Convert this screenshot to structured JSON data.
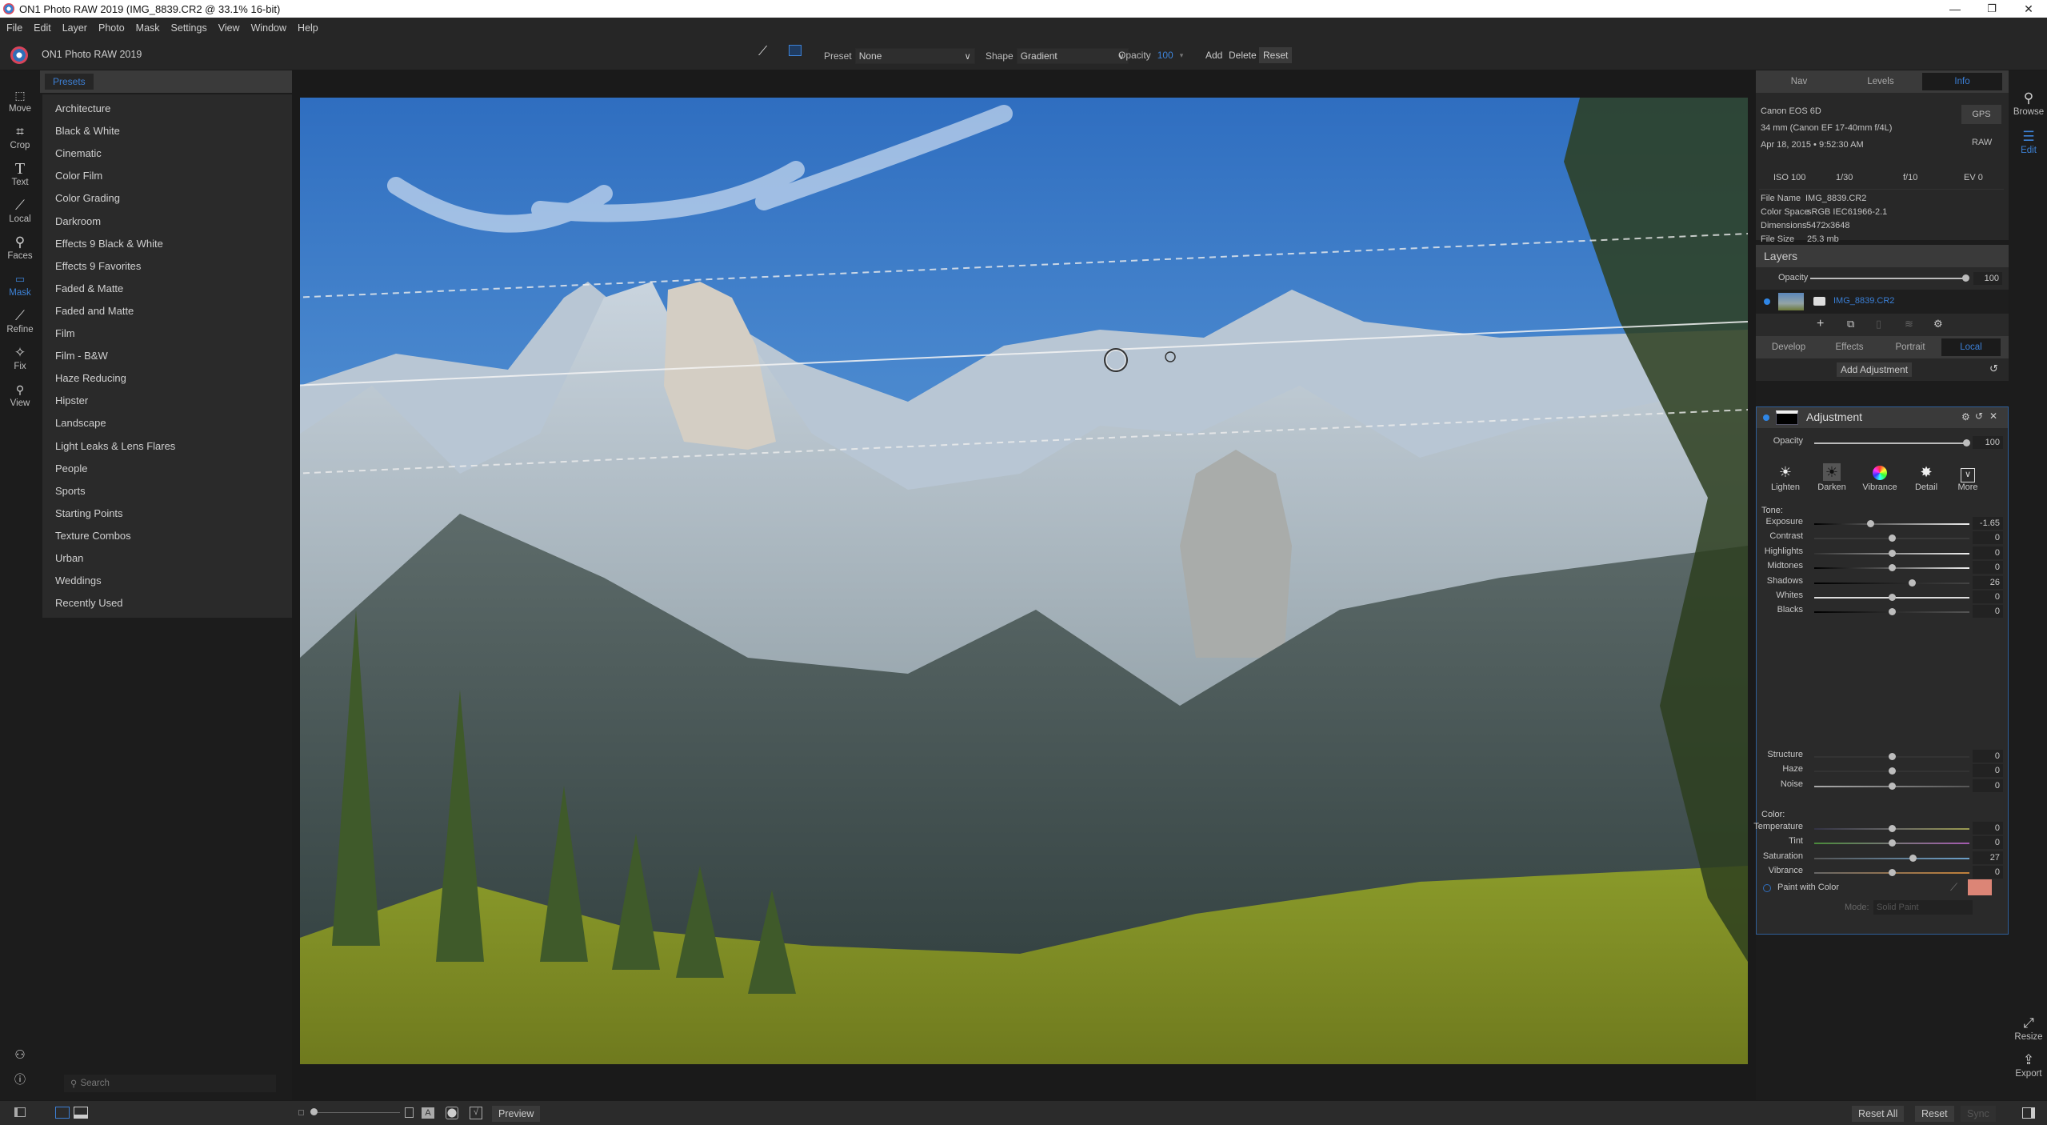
{
  "window": {
    "title": "ON1 Photo RAW 2019 (IMG_8839.CR2 @ 33.1% 16-bit)",
    "controls": {
      "minimize": "—",
      "maximize": "❐",
      "close": "✕"
    }
  },
  "menu": [
    "File",
    "Edit",
    "Layer",
    "Photo",
    "Mask",
    "Settings",
    "View",
    "Window",
    "Help"
  ],
  "app": {
    "name": "ON1 Photo RAW 2019"
  },
  "toolbar": {
    "preset_label": "Preset",
    "preset_value": "None",
    "shape_label": "Shape",
    "shape_value": "Gradient",
    "opacity_label": "Opacity",
    "opacity_value": "100",
    "add_label": "Add",
    "delete_label": "Delete",
    "reset_label": "Reset",
    "accent_color": "#3d82d6"
  },
  "tools": [
    {
      "label": "Move",
      "icon": "move-icon"
    },
    {
      "label": "Crop",
      "icon": "crop-icon"
    },
    {
      "label": "Text",
      "icon": "text-icon"
    },
    {
      "label": "Local",
      "icon": "local-brush-icon"
    },
    {
      "label": "Faces",
      "icon": "faces-icon"
    },
    {
      "label": "Mask",
      "icon": "mask-icon",
      "active": true
    },
    {
      "label": "Refine",
      "icon": "refine-icon"
    },
    {
      "label": "Fix",
      "icon": "fix-icon"
    },
    {
      "label": "View",
      "icon": "zoom-icon"
    }
  ],
  "presets": {
    "tab_label": "Presets",
    "items": [
      "Architecture",
      "Black & White",
      "Cinematic",
      "Color Film",
      "Color Grading",
      "Darkroom",
      "Effects 9 Black & White",
      "Effects 9 Favorites",
      "Faded & Matte",
      "Faded and Matte",
      "Film",
      "Film - B&W",
      "Haze Reducing",
      "Hipster",
      "Landscape",
      "Light Leaks & Lens Flares",
      "People",
      "Sports",
      "Starting Points",
      "Texture Combos",
      "Urban",
      "Weddings",
      "Recently Used"
    ],
    "search_placeholder": "Search"
  },
  "right_nav": {
    "browse_label": "Browse",
    "edit_label": "Edit",
    "resize_label": "Resize",
    "export_label": "Export"
  },
  "info_panel": {
    "tabs": [
      "Nav",
      "Levels",
      "Info"
    ],
    "active_tab": "Info",
    "camera": "Canon EOS 6D",
    "lens": "34 mm (Canon EF 17-40mm f/4L)",
    "date": "Apr 18, 2015 • 9:52:30 AM",
    "gps_label": "GPS",
    "format": "RAW",
    "iso": "ISO 100",
    "shutter": "1/30",
    "aperture": "f/10",
    "ev": "EV 0",
    "file_name_label": "File Name",
    "file_name": "IMG_8839.CR2",
    "color_space_label": "Color Space",
    "color_space": "sRGB IEC61966-2.1",
    "dimensions_label": "Dimensions",
    "dimensions": "5472x3648",
    "file_size_label": "File Size",
    "file_size": "25.3 mb"
  },
  "layers": {
    "title": "Layers",
    "opacity_label": "Opacity",
    "opacity_value": "100",
    "layer_name": "IMG_8839.CR2"
  },
  "module_tabs": [
    "Develop",
    "Effects",
    "Portrait",
    "Local"
  ],
  "active_module": "Local",
  "local": {
    "add_adjustment_label": "Add Adjustment",
    "adjustment_title": "Adjustment",
    "opacity_label": "Opacity",
    "opacity_value": "100",
    "presets": [
      "Lighten",
      "Darken",
      "Vibrance",
      "Detail",
      "More"
    ],
    "tone_label": "Tone:",
    "color_label": "Color:",
    "tone_sliders": [
      {
        "label": "Exposure",
        "value": "-1.65",
        "position": 0.36
      },
      {
        "label": "Contrast",
        "value": "0",
        "position": 0.5
      },
      {
        "label": "Highlights",
        "value": "0",
        "position": 0.5
      },
      {
        "label": "Midtones",
        "value": "0",
        "position": 0.5
      },
      {
        "label": "Shadows",
        "value": "26",
        "position": 0.63
      },
      {
        "label": "Whites",
        "value": "0",
        "position": 0.5
      },
      {
        "label": "Blacks",
        "value": "0",
        "position": 0.5
      }
    ],
    "detail_sliders": [
      {
        "label": "Structure",
        "value": "0",
        "position": 0.5
      },
      {
        "label": "Haze",
        "value": "0",
        "position": 0.5
      },
      {
        "label": "Noise",
        "value": "0",
        "position": 0.5
      }
    ],
    "color_sliders": [
      {
        "label": "Temperature",
        "value": "0",
        "position": 0.5
      },
      {
        "label": "Tint",
        "value": "0",
        "position": 0.5
      },
      {
        "label": "Saturation",
        "value": "27",
        "position": 0.635
      },
      {
        "label": "Vibrance",
        "value": "0",
        "position": 0.5
      }
    ],
    "paint_with_color_label": "Paint with Color",
    "paint_color": "#dc8576",
    "mode_label": "Mode:",
    "mode_value": "Solid Paint"
  },
  "bottom": {
    "preview_label": "Preview",
    "reset_all_label": "Reset All",
    "reset_label": "Reset",
    "sync_label": "Sync"
  }
}
